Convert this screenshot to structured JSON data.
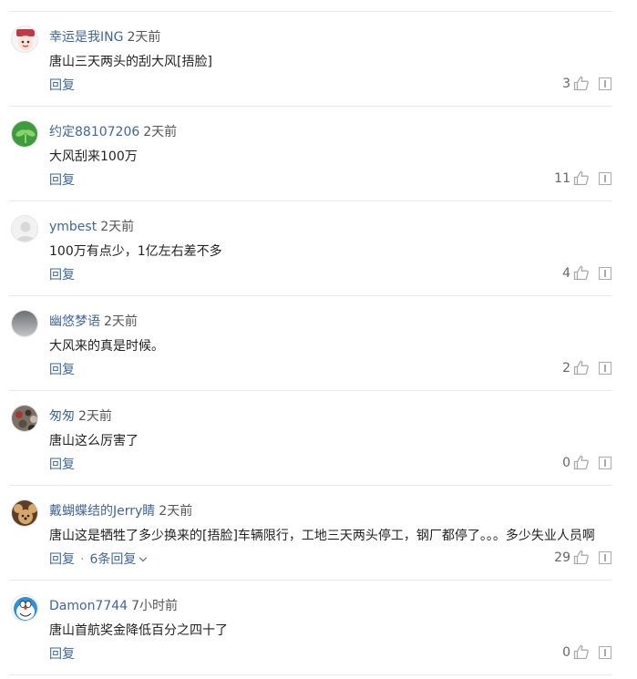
{
  "comments": [
    {
      "user": "幸运是我ING",
      "time": "2天前",
      "text": "唐山三天两头的刮大风[捂脸]",
      "reply_label": "回复",
      "likes": "3",
      "avatar_icon": "cartoon-face-avatar",
      "avatar_colors": [
        "#c03a45",
        "#f6f6f6"
      ]
    },
    {
      "user": "约定88107206",
      "time": "2天前",
      "text": "大风刮来100万",
      "reply_label": "回复",
      "likes": "11",
      "avatar_icon": "green-plant-avatar",
      "avatar_colors": [
        "#3e9b3e",
        "#8cd26a"
      ]
    },
    {
      "user": "ymbest",
      "time": "2天前",
      "text": "100万有点少，1亿左右差不多",
      "reply_label": "回复",
      "likes": "4",
      "avatar_icon": "default-person-avatar",
      "avatar_colors": [
        "#d8d8d8",
        "#f2f2f2"
      ]
    },
    {
      "user": "幽悠梦语",
      "time": "2天前",
      "text": "大风来的真是时候。",
      "reply_label": "回复",
      "likes": "2",
      "avatar_icon": "gray-sky-avatar",
      "avatar_colors": [
        "#6d6f74",
        "#c9cacd"
      ]
    },
    {
      "user": "匆匆",
      "time": "2天前",
      "text": "唐山这么厉害了",
      "reply_label": "回复",
      "likes": "0",
      "avatar_icon": "crowd-photo-avatar",
      "avatar_colors": [
        "#5a4d44",
        "#9e3b35"
      ]
    },
    {
      "user": "戴蝴蝶结的Jerry睛",
      "time": "2天前",
      "text": "唐山这是牺牲了多少换来的[捂脸]车辆限行，工地三天两头停工，钢厂都停了。。。多少失业人员啊",
      "reply_label": "回复",
      "replies_label": "6条回复",
      "likes": "29",
      "avatar_icon": "cartoon-mouse-avatar",
      "avatar_colors": [
        "#5b4027",
        "#d8a76a"
      ]
    },
    {
      "user": "Damon7744",
      "time": "7小时前",
      "text": "唐山首航奖金降低百分之四十了",
      "reply_label": "回复",
      "likes": "0",
      "avatar_icon": "doraemon-avatar",
      "avatar_colors": [
        "#2f8fd8",
        "#ffffff"
      ]
    }
  ],
  "icons": {
    "like": "thumbs-up-icon",
    "report": "report-icon",
    "expand": "chevron-down-icon"
  }
}
